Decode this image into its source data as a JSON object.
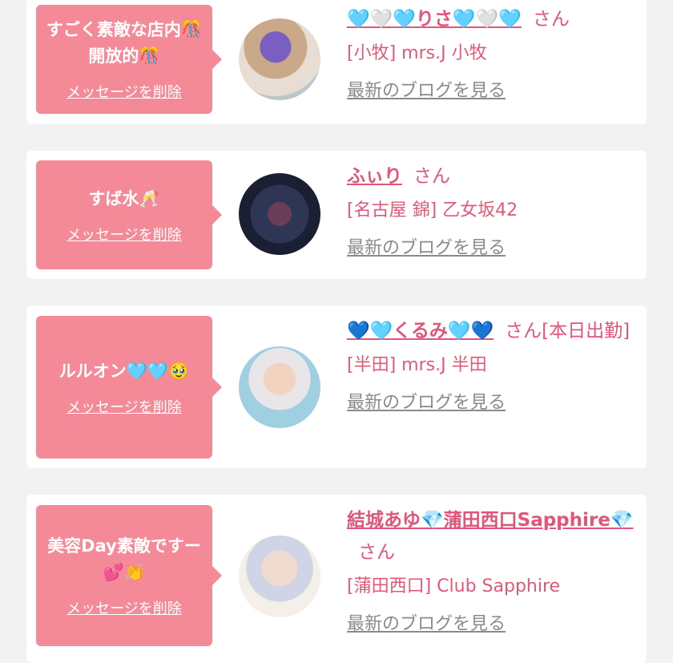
{
  "delete_label": "メッセージを削除",
  "blog_label": "最新のブログを見る",
  "san_label": "さん",
  "cards": [
    {
      "message": "すごく素敵な店内🎊開放的🎊",
      "name": "🩵🤍🩵りさ🩵🤍🩵",
      "san_suffix": "",
      "shop": "[小牧] mrs.J 小牧"
    },
    {
      "message": "すば水🥂",
      "name": "ふぃり",
      "san_suffix": "",
      "shop": "[名古屋 錦] 乙女坂42"
    },
    {
      "message": "ルルオン🩵🩵🥹",
      "name": "💙🩵くるみ🩵💙",
      "san_suffix": "[本日出勤]",
      "shop": "[半田] mrs.J 半田"
    },
    {
      "message": "美容Day素敵ですー💕👏",
      "name": "結城あゆ💎蒲田西口Sapphire💎",
      "san_suffix": "",
      "shop": "[蒲田西口] Club Sapphire"
    }
  ],
  "colors": {
    "bubble": "#f48a97",
    "name": "#e0567a",
    "link_gray": "#8a8a8a",
    "background": "#f2f2f2"
  }
}
